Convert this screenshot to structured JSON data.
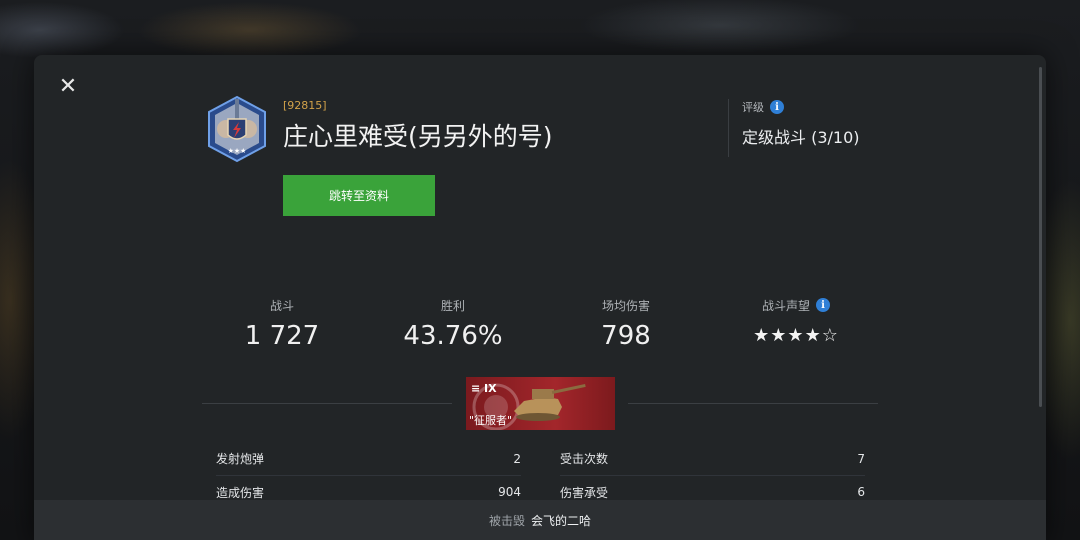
{
  "close_icon": "close-icon",
  "player": {
    "clan_tag": "[92815]",
    "name": "庄心里难受(另另外的号)",
    "profile_button": "跳转至资料",
    "emblem_icon": "rank-emblem-icon"
  },
  "rating": {
    "label": "评级",
    "value": "定级战斗 (3/10)"
  },
  "stats": [
    {
      "label": "战斗",
      "value": "1 727"
    },
    {
      "label": "胜利",
      "value": "43.76%"
    },
    {
      "label": "场均伤害",
      "value": "798"
    },
    {
      "label": "战斗声望",
      "value": "★★★★☆",
      "rating_stars": 4,
      "rating_max": 5
    }
  ],
  "tank": {
    "tier": "IX",
    "name": "\"征服者\""
  },
  "details": {
    "left": [
      {
        "label": "发射炮弹",
        "value": "2"
      },
      {
        "label": "造成伤害",
        "value": "904"
      }
    ],
    "right": [
      {
        "label": "受击次数",
        "value": "7"
      },
      {
        "label": "伤害承受",
        "value": "6"
      }
    ]
  },
  "footer": {
    "label": "被击毁",
    "value": "会飞的二哈"
  },
  "colors": {
    "accent_green": "#3aa33a",
    "info_blue": "#2f7fd6",
    "clan_tag": "#d2a24a",
    "tank_card": "#a3262b"
  }
}
